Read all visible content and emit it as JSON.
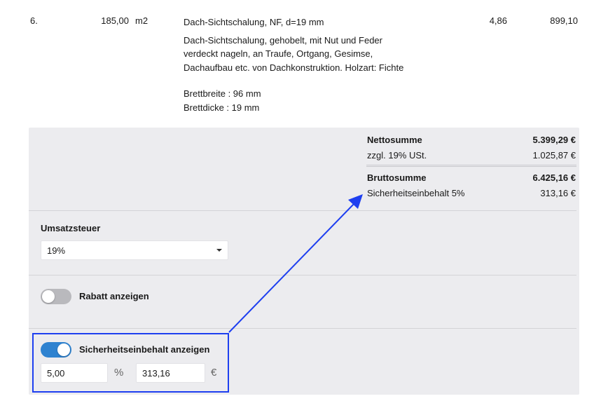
{
  "position": {
    "number": "6.",
    "quantity": "185,00",
    "unit": "m2",
    "title": "Dach-Sichtschalung, NF, d=19 mm",
    "description_lines": [
      "Dach-Sichtschalung, gehobelt, mit Nut und Feder",
      "verdeckt nageln, an Traufe, Ortgang, Gesimse,",
      "Dachaufbau etc. von Dachkonstruktion. Holzart: Fichte"
    ],
    "specs": [
      "Brettbreite : 96 mm",
      "Brettdicke : 19 mm"
    ],
    "unit_price": "4,86",
    "total_price": "899,10"
  },
  "totals": {
    "net_label": "Nettosumme",
    "net_value": "5.399,29 €",
    "vat_label": "zzgl. 19% USt.",
    "vat_value": "1.025,87 €",
    "gross_label": "Bruttosumme",
    "gross_value": "6.425,16 €",
    "retention_label": "Sicherheitseinbehalt 5%",
    "retention_value": "313,16 €"
  },
  "vat_section": {
    "label": "Umsatzsteuer",
    "selected": "19%"
  },
  "discount_section": {
    "label": "Rabatt anzeigen",
    "enabled": false
  },
  "retention_section": {
    "label": "Sicherheitseinbehalt anzeigen",
    "enabled": true,
    "percent_value": "5,00",
    "percent_symbol": "%",
    "amount_value": "313,16",
    "currency_symbol": "€"
  },
  "colors": {
    "panel_bg": "#ececef",
    "toggle_on": "#2e82d0",
    "toggle_off": "#b9b9bd",
    "annotation": "#1e3ff0"
  }
}
